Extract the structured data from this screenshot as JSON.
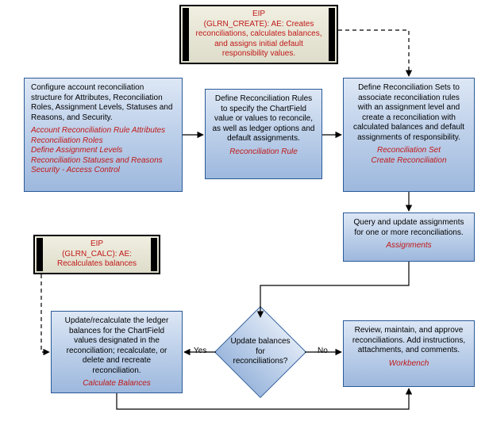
{
  "eip1": {
    "title": "EIP",
    "body": "(GLRN_CREATE): AE: Creates reconciliations, calculates balances, and assigns initial  default responsibility values."
  },
  "eip2": {
    "title": "EIP",
    "body": "(GLRN_CALC): AE: Recalculates balances"
  },
  "box_configure": {
    "desc": "Configure account reconciliation structure for Attributes, Reconciliation Roles, Assignment Levels, Statuses and Reasons, and Security.",
    "keys": "Account Reconciliation Rule Attributes\nReconciliation Roles\nDefine Assignment Levels\nReconciliation Statuses and Reasons\nSecurity - Access Control"
  },
  "box_rules": {
    "desc": "Define Reconciliation Rules to specify the ChartField value or values to reconcile, as well as ledger options and default assignments.",
    "keys": "Reconciliation Rule"
  },
  "box_sets": {
    "desc": "Define Reconciliation Sets to associate reconciliation rules with an assignment level and create a reconciliation with calculated balances and default assignments of responsibility.",
    "keys": "Reconciliation Set\nCreate Reconciliation"
  },
  "box_assignments": {
    "desc": "Query and update assignments for one or more reconciliations.",
    "keys": "Assignments"
  },
  "box_update_calc": {
    "desc": "Update/recalculate the ledger balances for the ChartField values designated in the reconciliation; recalculate, or delete and recreate reconciliation.",
    "keys": "Calculate Balances"
  },
  "box_workbench": {
    "desc": "Review, maintain, and approve reconciliations. Add instructions, attachments, and comments.",
    "keys": "Workbench"
  },
  "decision": {
    "text": "Update balances for reconciliations?",
    "yes": "Yes",
    "no": "No"
  },
  "chart_data": {
    "type": "flowchart",
    "nodes": [
      {
        "id": "eip_create",
        "type": "eip",
        "label": "EIP (GLRN_CREATE): AE: Creates reconciliations, calculates balances, and assigns initial default responsibility values."
      },
      {
        "id": "configure",
        "type": "process",
        "label": "Configure account reconciliation structure for Attributes, Reconciliation Roles, Assignment Levels, Statuses and Reasons, and Security.",
        "keys": [
          "Account Reconciliation Rule Attributes",
          "Reconciliation Roles",
          "Define Assignment Levels",
          "Reconciliation Statuses and Reasons",
          "Security - Access Control"
        ]
      },
      {
        "id": "rules",
        "type": "process",
        "label": "Define Reconciliation Rules to specify the ChartField value or values to reconcile, as well as ledger options and default assignments.",
        "keys": [
          "Reconciliation Rule"
        ]
      },
      {
        "id": "sets",
        "type": "process",
        "label": "Define Reconciliation Sets to associate reconciliation rules with an assignment level and create a reconciliation with calculated balances and default assignments of responsibility.",
        "keys": [
          "Reconciliation Set",
          "Create Reconciliation"
        ]
      },
      {
        "id": "assignments",
        "type": "process",
        "label": "Query and update assignments for one or more reconciliations.",
        "keys": [
          "Assignments"
        ]
      },
      {
        "id": "decision",
        "type": "decision",
        "label": "Update balances for reconciliations?"
      },
      {
        "id": "workbench",
        "type": "process",
        "label": "Review, maintain, and approve reconciliations. Add instructions, attachments, and comments.",
        "keys": [
          "Workbench"
        ]
      },
      {
        "id": "update_calc",
        "type": "process",
        "label": "Update/recalculate the ledger balances for the ChartField values designated in the reconciliation; recalculate, or delete and recreate reconciliation.",
        "keys": [
          "Calculate Balances"
        ]
      },
      {
        "id": "eip_calc",
        "type": "eip",
        "label": "EIP (GLRN_CALC): AE: Recalculates balances"
      }
    ],
    "edges": [
      {
        "from": "configure",
        "to": "rules"
      },
      {
        "from": "rules",
        "to": "sets"
      },
      {
        "from": "sets",
        "to": "assignments"
      },
      {
        "from": "assignments",
        "to": "decision"
      },
      {
        "from": "decision",
        "to": "workbench",
        "label": "No"
      },
      {
        "from": "decision",
        "to": "update_calc",
        "label": "Yes"
      },
      {
        "from": "update_calc",
        "to": "workbench"
      },
      {
        "from": "eip_create",
        "to": "sets",
        "style": "dashed"
      },
      {
        "from": "eip_calc",
        "to": "update_calc",
        "style": "dashed"
      }
    ]
  }
}
